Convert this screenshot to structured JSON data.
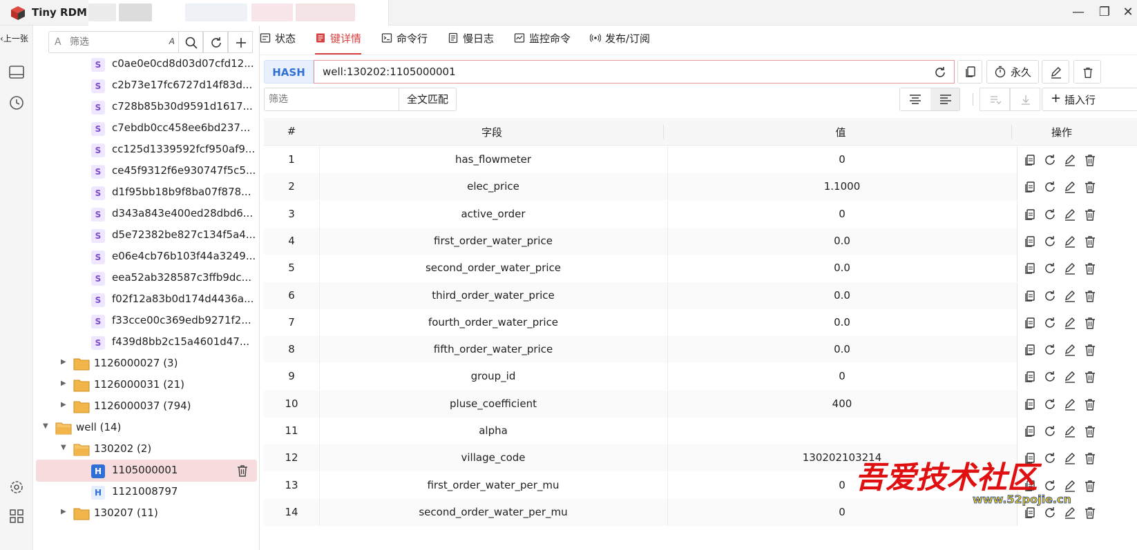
{
  "app": {
    "title": "Tiny RDM"
  },
  "rail": {
    "prev_label": "上一张"
  },
  "browser": {
    "filter_icon_label": "A",
    "filter_placeholder": "筛选",
    "case_label": "A",
    "items": [
      {
        "kind": "string",
        "badge": "S",
        "label": "c0ae0e0cd8d03d07cfd12..."
      },
      {
        "kind": "string",
        "badge": "S",
        "label": "c2b73e17fc6727d14f83d..."
      },
      {
        "kind": "string",
        "badge": "S",
        "label": "c728b85b30d9591d1617..."
      },
      {
        "kind": "string",
        "badge": "S",
        "label": "c7ebdb0cc458ee6bd237..."
      },
      {
        "kind": "string",
        "badge": "S",
        "label": "cc125d1339592fcf950af9..."
      },
      {
        "kind": "string",
        "badge": "S",
        "label": "ce45f9312f6e930747f5c5..."
      },
      {
        "kind": "string",
        "badge": "S",
        "label": "d1f95bb18b9f8ba07f878..."
      },
      {
        "kind": "string",
        "badge": "S",
        "label": "d343a843e400ed28dbd6..."
      },
      {
        "kind": "string",
        "badge": "S",
        "label": "d5e72382be827c134f5a4..."
      },
      {
        "kind": "string",
        "badge": "S",
        "label": "e06e4cb76b103f44a3249..."
      },
      {
        "kind": "string",
        "badge": "S",
        "label": "eea52ab328587c3ffb9dc..."
      },
      {
        "kind": "string",
        "badge": "S",
        "label": "f02f12a83b0d174d4436a..."
      },
      {
        "kind": "string",
        "badge": "S",
        "label": "f33cce00c369edb9271f2..."
      },
      {
        "kind": "string",
        "badge": "S",
        "label": "f439d8bb2c15a4601d47..."
      },
      {
        "kind": "folder",
        "label": "1126000027 (3)"
      },
      {
        "kind": "folder",
        "label": "1126000031 (21)"
      },
      {
        "kind": "folder",
        "label": "1126000037 (794)"
      },
      {
        "kind": "folder-open",
        "label": "well (14)"
      },
      {
        "kind": "folder-open",
        "label": "130202 (2)"
      },
      {
        "kind": "hash",
        "badge": "H",
        "label": "1105000001",
        "selected": true
      },
      {
        "kind": "hash",
        "badge": "H",
        "label": "1121008797"
      },
      {
        "kind": "folder",
        "label": "130207 (11)"
      }
    ]
  },
  "tabs": [
    {
      "label": "状态",
      "icon": "status-icon"
    },
    {
      "label": "键详情",
      "icon": "key-detail-icon",
      "active": true
    },
    {
      "label": "命令行",
      "icon": "terminal-icon"
    },
    {
      "label": "慢日志",
      "icon": "slow-log-icon"
    },
    {
      "label": "监控命令",
      "icon": "monitor-icon"
    },
    {
      "label": "发布/订阅",
      "icon": "pubsub-icon"
    }
  ],
  "key": {
    "type": "HASH",
    "name": "well:130202:1105000001",
    "ttl_label": "永久"
  },
  "value_filter": {
    "placeholder": "筛选",
    "full_match_label": "全文匹配",
    "insert_label": "插入行"
  },
  "table": {
    "columns": {
      "index": "#",
      "field": "字段",
      "value": "值",
      "ops": "操作"
    },
    "rows": [
      {
        "i": "1",
        "field": "has_flowmeter",
        "value": "0"
      },
      {
        "i": "2",
        "field": "elec_price",
        "value": "1.1000"
      },
      {
        "i": "3",
        "field": "active_order",
        "value": "0"
      },
      {
        "i": "4",
        "field": "first_order_water_price",
        "value": "0.0"
      },
      {
        "i": "5",
        "field": "second_order_water_price",
        "value": "0.0"
      },
      {
        "i": "6",
        "field": "third_order_water_price",
        "value": "0.0"
      },
      {
        "i": "7",
        "field": "fourth_order_water_price",
        "value": "0.0"
      },
      {
        "i": "8",
        "field": "fifth_order_water_price",
        "value": "0.0"
      },
      {
        "i": "9",
        "field": "group_id",
        "value": "0"
      },
      {
        "i": "10",
        "field": "pluse_coefficient",
        "value": "400"
      },
      {
        "i": "11",
        "field": "alpha",
        "value": ""
      },
      {
        "i": "12",
        "field": "village_code",
        "value": "130202103214"
      },
      {
        "i": "13",
        "field": "first_order_water_per_mu",
        "value": "0"
      },
      {
        "i": "14",
        "field": "second_order_water_per_mu",
        "value": "0"
      }
    ]
  },
  "watermark": {
    "text": "吾爱技术社区",
    "url": "www.52pojie.cn"
  },
  "colors": {
    "accent": "#d73f3f",
    "hash_blue": "#2f6fd6",
    "string_purple": "#7b4ccf",
    "folder": "#e8a43a"
  }
}
